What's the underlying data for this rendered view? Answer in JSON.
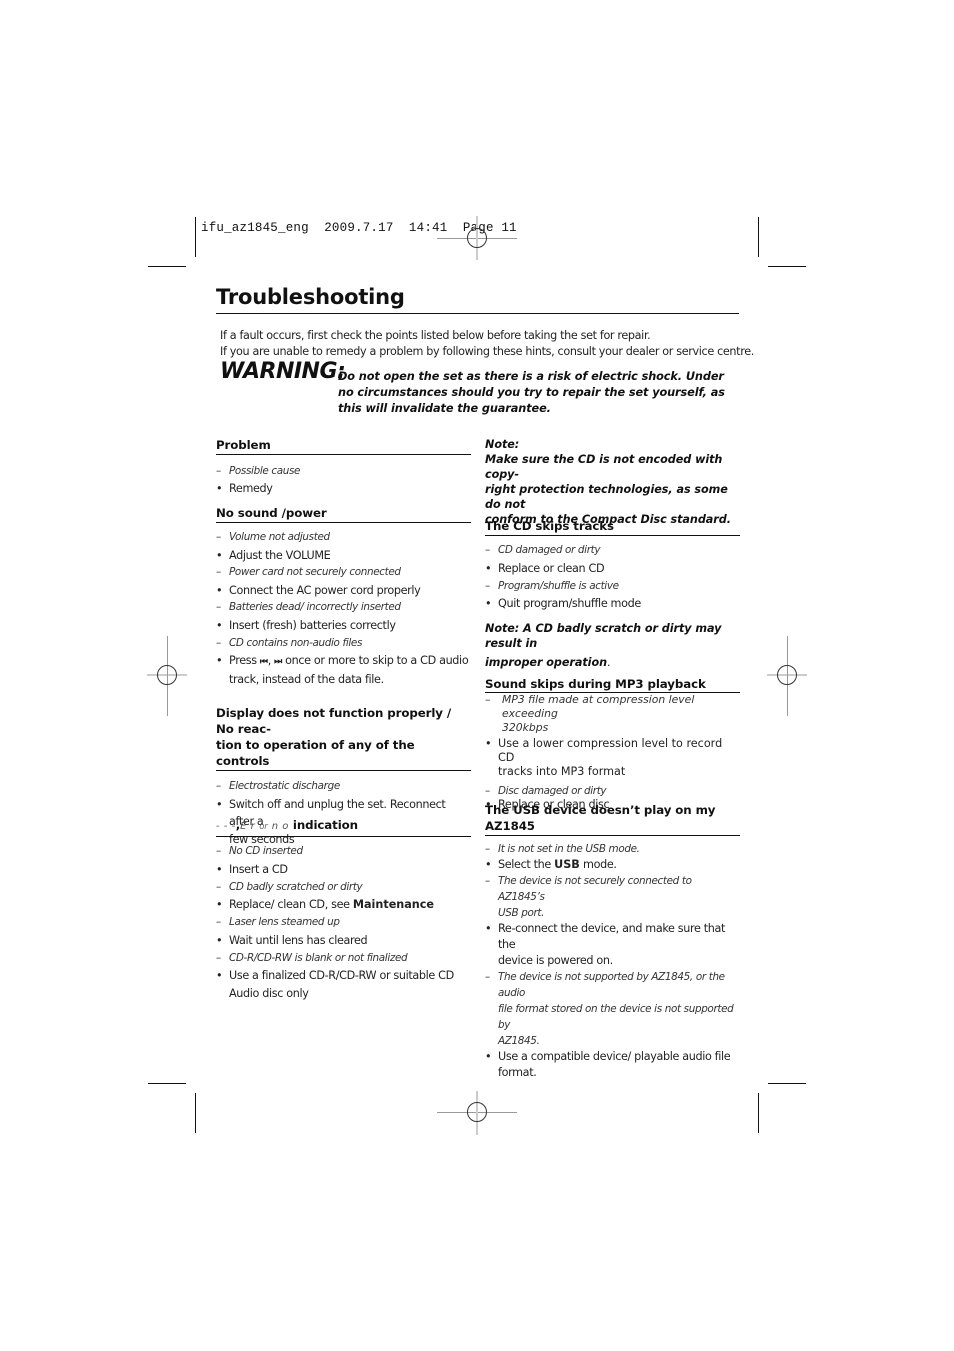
{
  "slug": "ifu_az1845_eng  2009.7.17  14:41  Page 11",
  "title": "Troubleshooting",
  "intro": [
    "If a fault occurs, first check the points listed below before taking the set for repair.",
    "If you are unable to remedy a problem by following these hints, consult your dealer or service centre."
  ],
  "warning": {
    "label": "WARNING:",
    "text": "Do not open the set as there is a risk of electric shock. Under no circumstances should you try to repair the set yourself, as this will invalidate the guarantee."
  },
  "legend": {
    "heading": "Problem",
    "cause": "Possible cause",
    "remedy": "Remedy"
  },
  "sections_left": {
    "no_sound": {
      "heading": "No sound /power",
      "items": [
        {
          "type": "cause",
          "text": "Volume not adjusted"
        },
        {
          "type": "remedy",
          "text": "Adjust the VOLUME"
        },
        {
          "type": "cause",
          "text": "Power card not securely connected"
        },
        {
          "type": "remedy",
          "text": "Connect the AC power cord properly"
        },
        {
          "type": "cause",
          "text": "Batteries dead/ incorrectly inserted"
        },
        {
          "type": "remedy",
          "text": "Insert (fresh) batteries correctly"
        },
        {
          "type": "cause",
          "text": "CD contains non-audio files"
        }
      ],
      "press": {
        "prefix": "Press",
        "prev_icon": "⏮",
        "sep": ",",
        "next_icon": "⏭",
        "suffix_line1": "once or more to skip to a CD audio",
        "suffix_line2": "track, instead of the data file."
      }
    },
    "display": {
      "heading_line1": "Display does not function properly / No reac-",
      "heading_line2": "tion to operation of any of the controls",
      "items": [
        {
          "type": "cause",
          "text": "Electrostatic discharge"
        },
        {
          "type": "remedy",
          "text": "Switch off and unplug the set. Reconnect after a"
        },
        {
          "type": "remedy-cont",
          "text": "few seconds"
        }
      ]
    },
    "indication": {
      "seg1": "- - -",
      "comma": ",",
      "seg2": "E r",
      "or": "or",
      "seg3": "n o",
      "heading": "indication",
      "items": [
        {
          "type": "cause",
          "text": "No CD inserted"
        },
        {
          "type": "remedy",
          "text": "Insert a CD"
        },
        {
          "type": "cause",
          "text": "CD badly scratched or dirty"
        }
      ],
      "replace": {
        "prefix": "Replace/ clean CD, see",
        "bold": "Maintenance"
      },
      "items2": [
        {
          "type": "cause",
          "text": "Laser lens steamed up"
        },
        {
          "type": "remedy",
          "text": "Wait until lens has cleared"
        },
        {
          "type": "cause",
          "text": "CD-R/CD-RW is blank or not finalized"
        },
        {
          "type": "remedy",
          "text": "Use a finalized CD-R/CD-RW or suitable CD"
        },
        {
          "type": "remedy-cont",
          "text": "Audio disc only"
        }
      ]
    }
  },
  "sections_right": {
    "note1": {
      "label": "Note:",
      "lines": [
        "Make sure the CD is not encoded with copy-",
        "right protection technologies, as some do not",
        "conform to the Compact Disc standard."
      ]
    },
    "cd_skips": {
      "heading": "The CD skips tracks",
      "items": [
        {
          "type": "cause",
          "text": "CD damaged or dirty"
        },
        {
          "type": "remedy",
          "text": "Replace or clean CD"
        },
        {
          "type": "cause",
          "text": "Program/shuffle is active"
        },
        {
          "type": "remedy",
          "text": "Quit program/shuffle mode"
        }
      ]
    },
    "note2": {
      "line1": "Note: A CD badly scratch or dirty may result in",
      "line2": "improper operation",
      "period": "."
    },
    "mp3": {
      "heading": "Sound skips during MP3 playback",
      "cause1_line1": "MP3 file made at compression level exceeding",
      "cause1_line2": "320kbps",
      "remedy1_line1": "Use a lower compression level to record CD",
      "remedy1_line2": "tracks into MP3 format",
      "cause2": "Disc damaged or dirty",
      "remedy2": "Replace or clean disc"
    },
    "usb": {
      "heading_line1": "The USB device doesn’t play on my",
      "heading_line2": "AZ1845",
      "cause1": "It is not set in the USB mode.",
      "remedy1": {
        "prefix": "Select the",
        "bold": "USB",
        "suffix": "mode."
      },
      "cause2_line1": "The device is not securely connected to AZ1845’s",
      "cause2_line2": "USB port.",
      "remedy2_line1": "Re-connect the device, and make sure that the",
      "remedy2_line2": "device is powered on.",
      "cause3_line1": "The device is not supported by AZ1845, or the audio",
      "cause3_line2": "file format stored on the device is not supported by",
      "cause3_line3": "AZ1845.",
      "remedy3_line1": "Use a compatible device/ playable audio file",
      "remedy3_line2": "format."
    }
  },
  "markers": {
    "dash": "–",
    "bullet": "•"
  }
}
